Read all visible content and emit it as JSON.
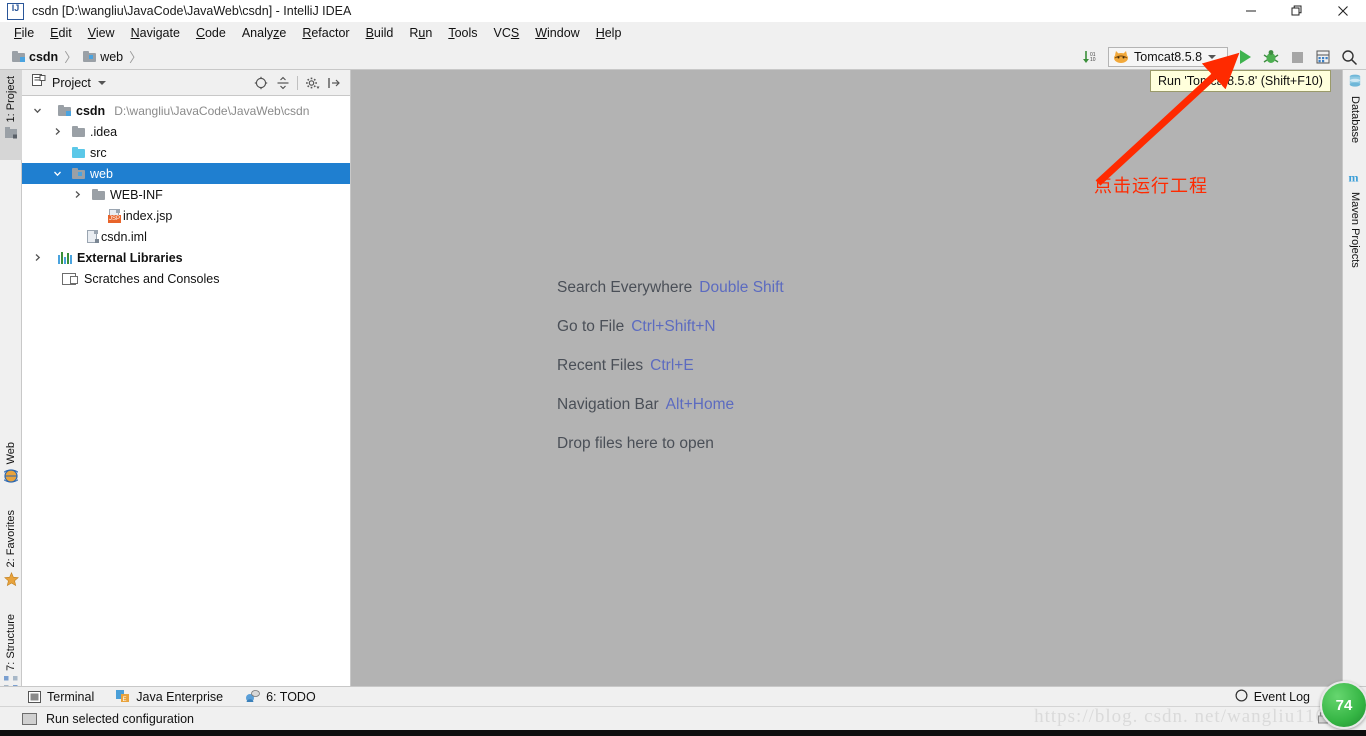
{
  "window": {
    "title": "csdn [D:\\wangliu\\JavaCode\\JavaWeb\\csdn] - IntelliJ IDEA",
    "app_icon": "intellij-idea-icon",
    "minimize": "minimize-icon",
    "maximize": "restore-icon",
    "close": "close-icon"
  },
  "menubar": {
    "items": [
      {
        "label": "File",
        "mnemonic": "F"
      },
      {
        "label": "Edit",
        "mnemonic": "E"
      },
      {
        "label": "View",
        "mnemonic": "V"
      },
      {
        "label": "Navigate",
        "mnemonic": "N"
      },
      {
        "label": "Code",
        "mnemonic": "C"
      },
      {
        "label": "Analyze",
        "mnemonic": "z"
      },
      {
        "label": "Refactor",
        "mnemonic": "R"
      },
      {
        "label": "Build",
        "mnemonic": "B"
      },
      {
        "label": "Run",
        "mnemonic": "u"
      },
      {
        "label": "Tools",
        "mnemonic": "T"
      },
      {
        "label": "VCS",
        "mnemonic": "S"
      },
      {
        "label": "Window",
        "mnemonic": "W"
      },
      {
        "label": "Help",
        "mnemonic": "H"
      }
    ]
  },
  "navbar": {
    "crumbs": [
      {
        "label": "csdn",
        "icon": "module-folder-icon"
      },
      {
        "label": "web",
        "icon": "web-folder-icon"
      }
    ],
    "separator": "〉"
  },
  "toolbar": {
    "compile_icon": "compile-binary-icon",
    "run_config": {
      "label": "Tomcat8.5.8",
      "icon": "tomcat-cat-icon",
      "chevron": "chevron-down-icon"
    },
    "run_button": "run-play-icon",
    "debug_button": "debug-bug-icon",
    "stop_button": "stop-square-icon",
    "db_button": "database-grid-icon",
    "search_button": "search-magnifier-icon"
  },
  "tooltip": {
    "text": "Run 'Tomcat8.5.8' (Shift+F10)"
  },
  "left_strip": {
    "tabs": [
      {
        "label": "1: Project",
        "icon": "project-icon",
        "active": true
      },
      {
        "label": "Web",
        "icon": "web-globe-icon",
        "active": false
      },
      {
        "label": "2: Favorites",
        "icon": "star-icon",
        "active": false
      },
      {
        "label": "7: Structure",
        "icon": "structure-icon",
        "active": false
      }
    ]
  },
  "right_strip": {
    "tabs": [
      {
        "label": "Database",
        "icon": "database-icon"
      },
      {
        "label": "Maven Projects",
        "icon": "maven-m-icon"
      }
    ]
  },
  "project_panel": {
    "title": "Project",
    "title_chevron": "chevron-down-icon",
    "header_icon": "project-view-icon",
    "actions": [
      {
        "name": "collapse-target-icon",
        "label": ""
      },
      {
        "name": "expand-all-icon",
        "label": ""
      },
      {
        "name": "settings-gear-icon",
        "label": ""
      },
      {
        "name": "hide-panel-icon",
        "label": ""
      }
    ],
    "tree": [
      {
        "label": "csdn",
        "path": "D:\\wangliu\\JavaCode\\JavaWeb\\csdn",
        "indent": 0,
        "arrow": "down",
        "icon": "module-folder-icon",
        "bold": true,
        "selected": false
      },
      {
        "label": ".idea",
        "path": "",
        "indent": 1,
        "arrow": "right",
        "icon": "folder-gray-icon",
        "bold": false,
        "selected": false
      },
      {
        "label": "src",
        "path": "",
        "indent": 1,
        "arrow": "none",
        "icon": "source-folder-icon",
        "bold": false,
        "selected": false
      },
      {
        "label": "web",
        "path": "",
        "indent": 1,
        "arrow": "down",
        "icon": "web-folder-icon",
        "bold": false,
        "selected": true
      },
      {
        "label": "WEB-INF",
        "path": "",
        "indent": 2,
        "arrow": "right",
        "icon": "folder-gray-icon",
        "bold": false,
        "selected": false
      },
      {
        "label": "index.jsp",
        "path": "",
        "indent": 3,
        "arrow": "none",
        "icon": "jsp-file-icon",
        "bold": false,
        "selected": false
      },
      {
        "label": "csdn.iml",
        "path": "",
        "indent": 2,
        "arrow": "none",
        "icon": "iml-file-icon",
        "bold": false,
        "selected": false
      },
      {
        "label": "External Libraries",
        "path": "",
        "indent": 0,
        "arrow": "right",
        "icon": "libraries-icon",
        "bold": false,
        "selected": false
      },
      {
        "label": "Scratches and Consoles",
        "path": "",
        "indent": 1,
        "arrow": "none",
        "icon": "scratches-icon",
        "bold": false,
        "selected": false
      }
    ]
  },
  "editor": {
    "background_color": "#b3b3b3",
    "hints": [
      {
        "action": "Search Everywhere",
        "key": "Double Shift"
      },
      {
        "action": "Go to File",
        "key": "Ctrl+Shift+N"
      },
      {
        "action": "Recent Files",
        "key": "Ctrl+E"
      },
      {
        "action": "Navigation Bar",
        "key": "Alt+Home"
      },
      {
        "action": "Drop files here to open",
        "key": ""
      }
    ]
  },
  "annotation": {
    "text": "点击运行工程",
    "color": "#ff2a00",
    "arrow": "red-arrow-pointer"
  },
  "bottom_bar": {
    "items": [
      {
        "label": "Terminal",
        "icon": "terminal-icon"
      },
      {
        "label": "Java Enterprise",
        "icon": "java-enterprise-icon"
      },
      {
        "label": "6: TODO",
        "icon": "todo-icon"
      }
    ],
    "event_log": {
      "label": "Event Log",
      "icon": "event-log-icon"
    }
  },
  "status_bar": {
    "text": "Run selected configuration",
    "icon": "run-config-status-icon",
    "lock_icon": "lock-icon"
  },
  "watermark": {
    "text": "https://blog. csdn. net/wangliu110"
  },
  "badge": {
    "value": "74"
  }
}
